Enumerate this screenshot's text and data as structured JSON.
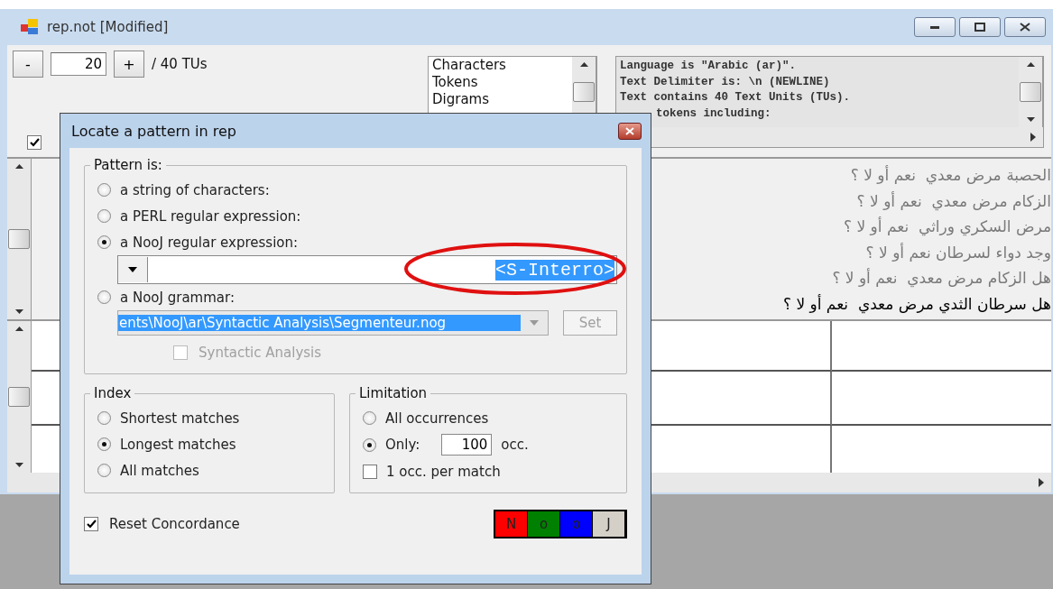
{
  "window": {
    "title": "rep.not [Modified]"
  },
  "navigator": {
    "decrement": "-",
    "value": "20",
    "increment": "+",
    "total": "/ 40 TUs"
  },
  "stats_list": [
    "Characters",
    "Tokens",
    "Digrams"
  ],
  "info_lines": [
    "Language is \"Arabic (ar)\".",
    "Text Delimiter is: \\n (NEWLINE)",
    "Text contains 40 Text Units (TUs).",
    "tokens including:"
  ],
  "show_checkbox": {
    "checked": true
  },
  "text_units": [
    {
      "text": "الحصبة مرض معدي  نعم أو لا ؟",
      "current": false
    },
    {
      "text": "الزكام مرض معدي  نعم أو لا ؟",
      "current": false
    },
    {
      "text": "مرض السكري وراثي  نعم أو لا ؟",
      "current": false
    },
    {
      "text": "وجد دواء لسرطان نعم أو لا ؟",
      "current": false
    },
    {
      "text": "هل الزكام مرض معدي  نعم أو لا ؟",
      "current": false
    },
    {
      "text": "هل سرطان الثدي مرض معدي  نعم أو لا ؟",
      "current": true
    }
  ],
  "dialog": {
    "title": "Locate a pattern in rep",
    "pattern_group": {
      "label": "Pattern is:",
      "options": [
        {
          "kind": "plain",
          "label": "a string of characters:",
          "selected": false
        },
        {
          "kind": "plain",
          "label": "a PERL regular expression:",
          "selected": false
        },
        {
          "kind": "regex",
          "label": "a NooJ regular expression:",
          "selected": true
        },
        {
          "kind": "grammar",
          "label": "a NooJ grammar:",
          "selected": false
        }
      ]
    },
    "regex_field": {
      "value": "<S-Interro>",
      "highlighted": true
    },
    "grammar_field": {
      "value": "ents\\NooJ\\ar\\Syntactic Analysis\\Segmenteur.nog",
      "disabled": true
    },
    "set_button": {
      "label": "Set",
      "disabled": true
    },
    "syntactic_checkbox": {
      "label": "Syntactic Analysis",
      "checked": false,
      "disabled": true
    },
    "index": {
      "label": "Index",
      "options": [
        {
          "label": "Shortest matches",
          "selected": false
        },
        {
          "label": "Longest matches",
          "selected": true
        },
        {
          "label": "All matches",
          "selected": false
        }
      ]
    },
    "limitation": {
      "label": "Limitation",
      "options": [
        {
          "label": "All occurrences",
          "selected": false
        },
        {
          "label": "Only:",
          "selected": true
        }
      ],
      "count": "100",
      "unit": "occ.",
      "per_match": {
        "label": "1 occ. per match",
        "checked": false
      }
    },
    "reset": {
      "label": "Reset Concordance",
      "checked": true
    },
    "color_buttons": [
      {
        "label": "N",
        "color": "#ff0000"
      },
      {
        "label": "o",
        "color": "#008000"
      },
      {
        "label": "o",
        "color": "#0000ff"
      },
      {
        "label": "J",
        "color": "#d4d0c8"
      }
    ]
  }
}
